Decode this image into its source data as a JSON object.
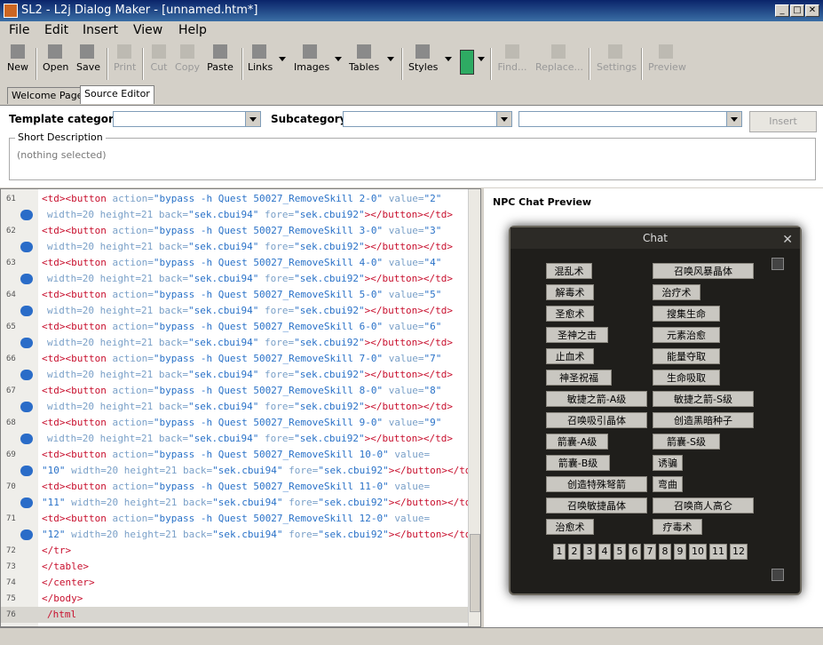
{
  "window": {
    "title": "SL2 - L2j Dialog Maker - [unnamed.htm*]"
  },
  "menu": [
    "File",
    "Edit",
    "Insert",
    "View",
    "Help"
  ],
  "toolbar": {
    "new": "New",
    "open": "Open",
    "save": "Save",
    "print": "Print",
    "cut": "Cut",
    "copy": "Copy",
    "paste": "Paste",
    "links": "Links",
    "images": "Images",
    "tables": "Tables",
    "styles": "Styles",
    "find": "Find...",
    "replace": "Replace...",
    "settings": "Settings",
    "preview": "Preview",
    "color_swatch": "#2eab63"
  },
  "tabs": [
    "Welcome Page",
    "Source Editor"
  ],
  "form": {
    "template_category_label": "Template category",
    "subcategory_label": "Subcategory",
    "insert_label": "Insert",
    "short_description_label": "Short Description",
    "short_description_value": "(nothing selected)"
  },
  "editor": {
    "lines": [
      {
        "n": "61",
        "bp": false,
        "kind": "btn1",
        "num": "2"
      },
      {
        "n": "",
        "bp": true,
        "kind": "cont1"
      },
      {
        "n": "62",
        "bp": false,
        "kind": "btn1",
        "num": "3"
      },
      {
        "n": "",
        "bp": true,
        "kind": "cont1"
      },
      {
        "n": "63",
        "bp": false,
        "kind": "btn1",
        "num": "4"
      },
      {
        "n": "",
        "bp": true,
        "kind": "cont1"
      },
      {
        "n": "64",
        "bp": false,
        "kind": "btn1",
        "num": "5"
      },
      {
        "n": "",
        "bp": true,
        "kind": "cont1"
      },
      {
        "n": "65",
        "bp": false,
        "kind": "btn1",
        "num": "6"
      },
      {
        "n": "",
        "bp": true,
        "kind": "cont1"
      },
      {
        "n": "66",
        "bp": false,
        "kind": "btn1",
        "num": "7"
      },
      {
        "n": "",
        "bp": true,
        "kind": "cont1"
      },
      {
        "n": "67",
        "bp": false,
        "kind": "btn1",
        "num": "8"
      },
      {
        "n": "",
        "bp": true,
        "kind": "cont1"
      },
      {
        "n": "68",
        "bp": false,
        "kind": "btn1",
        "num": "9"
      },
      {
        "n": "",
        "bp": true,
        "kind": "cont1"
      },
      {
        "n": "69",
        "bp": false,
        "kind": "btn2",
        "num": "10"
      },
      {
        "n": "",
        "bp": true,
        "kind": "cont2",
        "num": "10"
      },
      {
        "n": "70",
        "bp": false,
        "kind": "btn2",
        "num": "11"
      },
      {
        "n": "",
        "bp": true,
        "kind": "cont2",
        "num": "11"
      },
      {
        "n": "71",
        "bp": false,
        "kind": "btn2",
        "num": "12"
      },
      {
        "n": "",
        "bp": true,
        "kind": "cont2",
        "num": "12"
      },
      {
        "n": "72",
        "bp": false,
        "kind": "close",
        "text": "</tr>"
      },
      {
        "n": "73",
        "bp": false,
        "kind": "close",
        "text": "</table>"
      },
      {
        "n": "74",
        "bp": false,
        "kind": "close",
        "text": "</center>"
      },
      {
        "n": "75",
        "bp": false,
        "kind": "close",
        "text": "</body>"
      },
      {
        "n": "76",
        "bp": false,
        "kind": "last",
        "text": "/html"
      }
    ],
    "strings": {
      "td_open": "<td>",
      "btn_open": "<button",
      "action_attr": " action=",
      "bypass_prefix": "\"bypass -h Quest 50027_RemoveSkill ",
      "suffix_value": "-0\"",
      "value_attr": " value=",
      "width_height": " width=20 height=21 back=",
      "back_val": "\"sek.cbui94\"",
      "fore_attr": " fore=",
      "fore_val": "\"sek.cbui92\"",
      "close_button": "></button></td>"
    }
  },
  "preview": {
    "title": "NPC Chat Preview",
    "chat_title": "Chat",
    "close_glyph": "✕",
    "buttons_left": [
      "混乱术",
      "解毒术",
      "圣愈术",
      "圣神之击",
      "止血术",
      "神圣祝福",
      "敏捷之箭-A级",
      "召唤吸引晶体",
      "箭囊-A级",
      "箭囊-B级",
      "创造特殊弩箭",
      "召唤敏捷晶体",
      "治愈术"
    ],
    "buttons_right": [
      "召唤风暴晶体",
      "治疗术",
      "搜集生命",
      "元素治愈",
      "能量夺取",
      "生命吸取",
      "敏捷之箭-S级",
      "创造黑暗种子",
      "箭囊-S级",
      "诱骗",
      "弯曲",
      "召唤商人高仑",
      "疗毒术"
    ],
    "pages": [
      "1",
      "2",
      "3",
      "4",
      "5",
      "6",
      "7",
      "8",
      "9",
      "10",
      "11",
      "12"
    ]
  }
}
